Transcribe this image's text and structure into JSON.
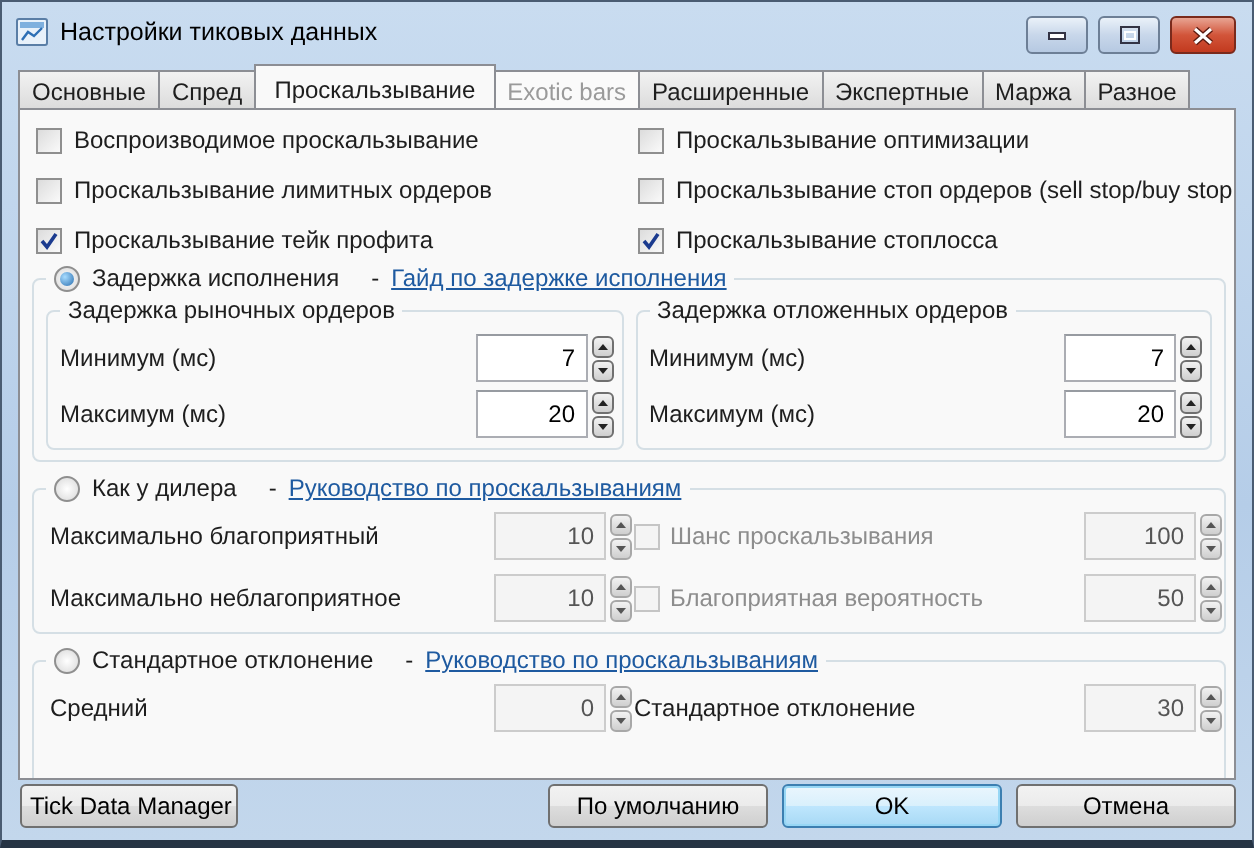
{
  "window": {
    "title": "Настройки тиковых данных"
  },
  "tabs": [
    {
      "label": "Основные",
      "selected": false,
      "disabled": false
    },
    {
      "label": "Спред",
      "selected": false,
      "disabled": false
    },
    {
      "label": "Проскальзывание",
      "selected": true,
      "disabled": false
    },
    {
      "label": "Exotic bars",
      "selected": false,
      "disabled": true
    },
    {
      "label": "Расширенные",
      "selected": false,
      "disabled": false
    },
    {
      "label": "Экспертные",
      "selected": false,
      "disabled": false
    },
    {
      "label": "Маржа",
      "selected": false,
      "disabled": false
    },
    {
      "label": "Разное",
      "selected": false,
      "disabled": false
    }
  ],
  "checkboxes": [
    {
      "label": "Воспроизводимое проскальзывание",
      "checked": false
    },
    {
      "label": "Проскальзывание оптимизации",
      "checked": false
    },
    {
      "label": "Проскальзывание лимитных ордеров",
      "checked": false
    },
    {
      "label": "Проскальзывание стоп ордеров (sell stop/buy stop",
      "checked": false
    },
    {
      "label": "Проскальзывание тейк профита",
      "checked": true
    },
    {
      "label": "Проскальзывание стоплосса",
      "checked": true
    }
  ],
  "delay": {
    "label": "Задержка исполнения",
    "selected": true,
    "dash": "-",
    "link": "Гайд по задержке исполнения",
    "groups": [
      {
        "title": "Задержка рыночных ордеров",
        "fields": [
          {
            "label": "Минимум (мс)",
            "value": "7"
          },
          {
            "label": "Максимум (мс)",
            "value": "20"
          }
        ]
      },
      {
        "title": "Задержка отложенных ордеров",
        "fields": [
          {
            "label": "Минимум (мс)",
            "value": "7"
          },
          {
            "label": "Максимум (мс)",
            "value": "20"
          }
        ]
      }
    ]
  },
  "dealer": {
    "label": "Как у дилера",
    "selected": false,
    "dash": "-",
    "link": "Руководство по проскальзываниям",
    "rows": [
      {
        "label": "Максимально благоприятный",
        "value": "10",
        "option": {
          "label": "Шанс проскальзывания",
          "checked": false
        },
        "option_value": "100"
      },
      {
        "label": "Максимально неблагоприятное",
        "value": "10",
        "option": {
          "label": "Благоприятная вероятность",
          "checked": false
        },
        "option_value": "50"
      }
    ]
  },
  "stddev": {
    "label": "Стандартное отклонение",
    "selected": false,
    "dash": "-",
    "link": "Руководство по проскальзываниям",
    "fields": [
      {
        "label": "Средний",
        "value": "0"
      },
      {
        "label": "Стандартное отклонение",
        "value": "30"
      }
    ]
  },
  "buttons": [
    {
      "label": "Tick Data Manager",
      "default": false
    },
    {
      "label": "По умолчанию",
      "default": false
    },
    {
      "label": "OK",
      "default": true
    },
    {
      "label": "Отмена",
      "default": false
    }
  ]
}
